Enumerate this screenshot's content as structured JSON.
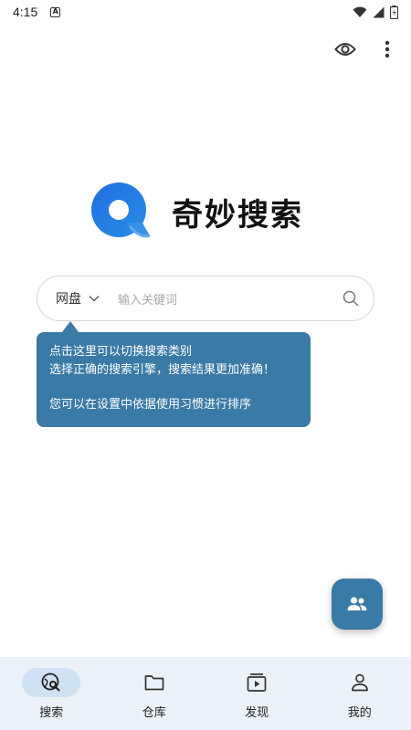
{
  "status_bar": {
    "time": "4:15",
    "notification_letter": "A"
  },
  "app": {
    "title": "奇妙搜索",
    "brand_color": "#3a7aa6"
  },
  "top_actions": {
    "icons": [
      "eye-icon",
      "more-vert-icon"
    ]
  },
  "search": {
    "category_label": "网盘",
    "placeholder": "输入关键词"
  },
  "tooltip": {
    "line1": "点击这里可以切换搜索类别",
    "line2": "选择正确的搜索引擎，搜索结果更加准确！",
    "line3": "您可以在设置中依据使用习惯进行排序"
  },
  "fab": {
    "icon": "group-icon"
  },
  "bottom_nav": {
    "items": [
      {
        "label": "搜索",
        "icon": "search-globe-icon",
        "active": true
      },
      {
        "label": "仓库",
        "icon": "folder-icon",
        "active": false
      },
      {
        "label": "发现",
        "icon": "play-square-icon",
        "active": false
      },
      {
        "label": "我的",
        "icon": "person-icon",
        "active": false
      }
    ]
  }
}
